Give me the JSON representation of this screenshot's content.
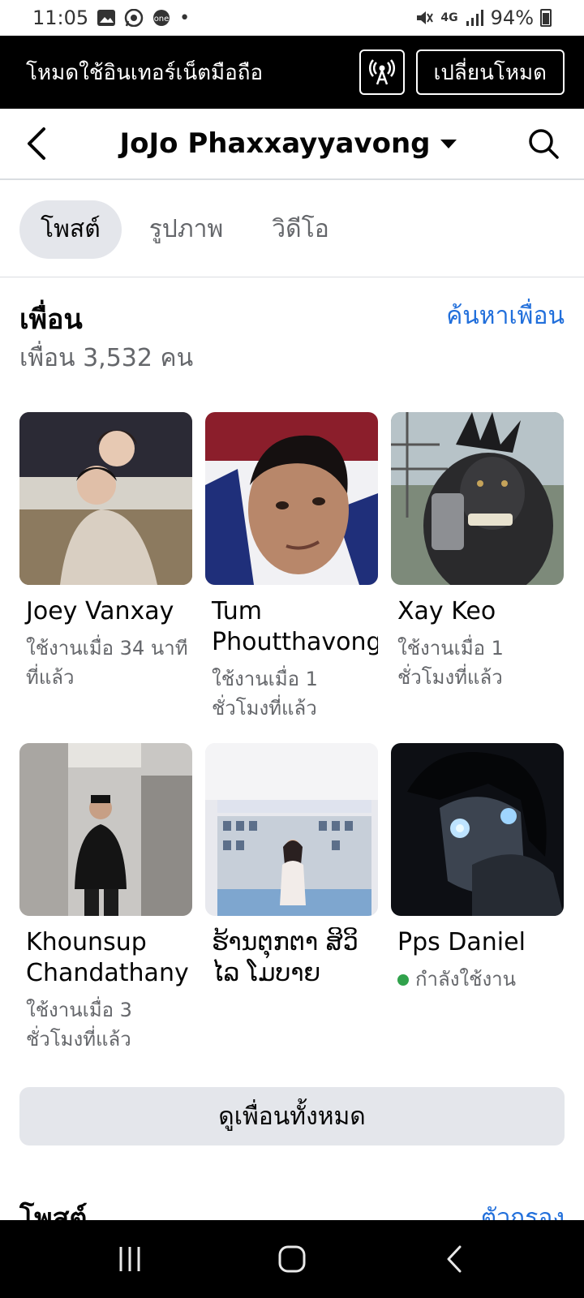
{
  "status_bar": {
    "time": "11:05",
    "battery": "94%",
    "network": "4G"
  },
  "mode_banner": {
    "text": "โหมดใช้อินเทอร์เน็ตมือถือ",
    "switch_label": "เปลี่ยนโหมด"
  },
  "header": {
    "title": "JoJo Phaxxayyavong"
  },
  "tabs": [
    {
      "label": "โพสต์",
      "active": true
    },
    {
      "label": "รูปภาพ",
      "active": false
    },
    {
      "label": "วิดีโอ",
      "active": false
    }
  ],
  "friends": {
    "title": "เพื่อน",
    "find_link": "ค้นหาเพื่อน",
    "count_text": "เพื่อน 3,532 คน",
    "list": [
      {
        "name": "Joey Vanxay",
        "status": "ใช้งานเมื่อ 34 นาทีที่แล้ว"
      },
      {
        "name": "Tum Phoutthavong",
        "status": "ใช้งานเมื่อ 1 ชั่วโมงที่แล้ว"
      },
      {
        "name": "Xay Keo",
        "status": "ใช้งานเมื่อ 1 ชั่วโมงที่แล้ว"
      },
      {
        "name": "Khounsup Chandathany",
        "status": "ใช้งานเมื่อ 3 ชั่วโมงที่แล้ว"
      },
      {
        "name": "ຮ້ານຕຸກຕາ ສິວິໄລ ໂມບາຍ",
        "status": ""
      },
      {
        "name": "Pps Daniel",
        "status": "กำลังใช้งาน",
        "online": true
      }
    ],
    "see_all_label": "ดูเพื่อนทั้งหมด"
  },
  "posts": {
    "title": "โพสต์",
    "filter_label": "ตัวกรอง"
  }
}
